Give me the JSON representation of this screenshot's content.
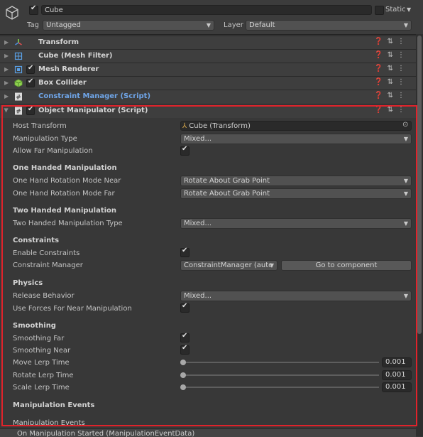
{
  "header": {
    "object_name": "Cube",
    "active": true,
    "static_label": "Static",
    "tag_label": "Tag",
    "tag_value": "Untagged",
    "layer_label": "Layer",
    "layer_value": "Default"
  },
  "components": [
    {
      "name": "Transform",
      "icon": "transform-icon",
      "has_toggle": false
    },
    {
      "name": "Cube (Mesh Filter)",
      "icon": "mesh-filter-icon",
      "has_toggle": false
    },
    {
      "name": "Mesh Renderer",
      "icon": "mesh-renderer-icon",
      "has_toggle": true
    },
    {
      "name": "Box Collider",
      "icon": "box-collider-icon",
      "has_toggle": true
    },
    {
      "name": "Constraint Manager (Script)",
      "icon": "script-icon",
      "has_toggle": false
    },
    {
      "name": "Object Manipulator (Script)",
      "icon": "script-icon",
      "has_toggle": true
    }
  ],
  "manipulator": {
    "host_transform_label": "Host Transform",
    "host_transform_value": "Cube (Transform)",
    "manipulation_type_label": "Manipulation Type",
    "manipulation_type_value": "Mixed...",
    "allow_far_label": "Allow Far Manipulation",
    "allow_far_checked": true,
    "one_handed_header": "One Handed Manipulation",
    "near_label": "One Hand Rotation Mode Near",
    "near_value": "Rotate About Grab Point",
    "far_label": "One Hand Rotation Mode Far",
    "far_value": "Rotate About Grab Point",
    "two_handed_header": "Two Handed Manipulation",
    "two_handed_type_label": "Two Handed Manipulation Type",
    "two_handed_type_value": "Mixed...",
    "constraints_header": "Constraints",
    "enable_constraints_label": "Enable Constraints",
    "enable_constraints_checked": true,
    "constraint_manager_label": "Constraint Manager",
    "constraint_manager_value": "ConstraintManager (auto",
    "go_to_component_label": "Go to component",
    "physics_header": "Physics",
    "release_behavior_label": "Release Behavior",
    "release_behavior_value": "Mixed...",
    "use_forces_label": "Use Forces For Near Manipulation",
    "use_forces_checked": true,
    "smoothing_header": "Smoothing",
    "smoothing_far_label": "Smoothing Far",
    "smoothing_far_checked": true,
    "smoothing_near_label": "Smoothing Near",
    "smoothing_near_checked": true,
    "move_lerp_label": "Move Lerp Time",
    "move_lerp_value": "0.001",
    "rotate_lerp_label": "Rotate Lerp Time",
    "rotate_lerp_value": "0.001",
    "scale_lerp_label": "Scale Lerp Time",
    "scale_lerp_value": "0.001",
    "events_header": "Manipulation Events",
    "events_subheader": "Manipulation Events",
    "event_started_label": "On Manipulation Started (ManipulationEventData)"
  },
  "colors": {
    "highlight": "#e0232b",
    "script_title": "#6fa5e8",
    "background": "#383838"
  }
}
